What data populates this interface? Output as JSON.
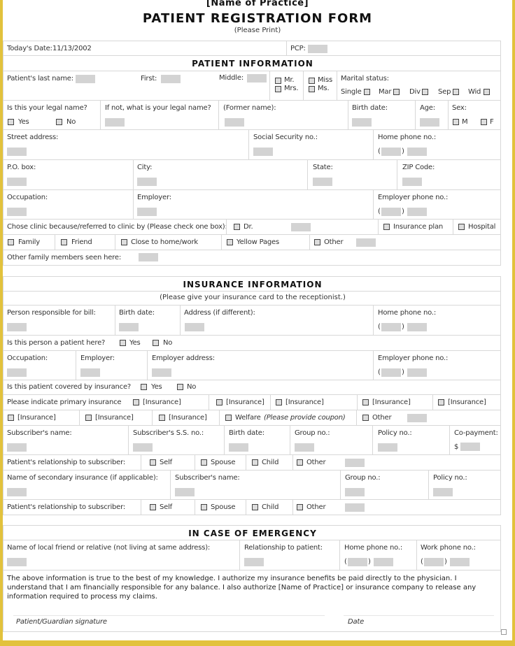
{
  "header": {
    "practice_name": "[Name of Practice]",
    "title": "PATIENT REGISTRATION FORM",
    "subtitle": "(Please Print)"
  },
  "top": {
    "todays_date_label": "Today's Date:",
    "todays_date_value": "11/13/2002",
    "pcp_label": "PCP:"
  },
  "patient_info": {
    "heading": "PATIENT INFORMATION",
    "last_name": "Patient's last name:",
    "first": "First:",
    "middle": "Middle:",
    "titles": [
      "Mr.",
      "Mrs.",
      "Miss",
      "Ms."
    ],
    "marital_status": "Marital status:",
    "marital_options": [
      "Single",
      "Mar",
      "Div",
      "Sep",
      "Wid"
    ],
    "legal_name_q": "Is this your legal name?",
    "yes": "Yes",
    "no": "No",
    "if_not": "If not, what is your legal name?",
    "former_name": "(Former name):",
    "birth_date": "Birth date:",
    "age": "Age:",
    "sex": "Sex:",
    "sex_options": [
      "M",
      "F"
    ],
    "street": "Street address:",
    "ssn": "Social Security no.:",
    "home_phone": "Home phone no.:",
    "po_box": "P.O. box:",
    "city": "City:",
    "state": "State:",
    "zip": "ZIP Code:",
    "occupation": "Occupation:",
    "employer": "Employer:",
    "employer_phone": "Employer phone no.:",
    "paren_open": "(",
    "paren_close": ")",
    "chose_clinic": "Chose clinic because/referred to clinic by (Please check one box):",
    "referral_row1": [
      "Dr.",
      "Insurance plan",
      "Hospital"
    ],
    "referral_row2": [
      "Family",
      "Friend",
      "Close to home/work",
      "Yellow Pages",
      "Other"
    ],
    "other_family": "Other family members seen here:"
  },
  "insurance_info": {
    "heading": "INSURANCE INFORMATION",
    "note": "(Please give your insurance card to the receptionist.)",
    "person_responsible": "Person responsible for bill:",
    "birth_date": "Birth date:",
    "address": "Address (if different):",
    "home_phone": "Home phone no.:",
    "is_patient_q": "Is this person a patient here?",
    "yes": "Yes",
    "no": "No",
    "occupation": "Occupation:",
    "employer": "Employer:",
    "employer_address": "Employer address:",
    "employer_phone": "Employer phone no.:",
    "covered_q": "Is this patient covered by insurance?",
    "primary_label": "Please indicate primary insurance",
    "insurance_option": "[Insurance]",
    "welfare": "Welfare",
    "welfare_note": "(Please provide coupon)",
    "other": "Other",
    "subscriber_name": "Subscriber's name:",
    "subscriber_ss": "Subscriber's S.S. no.:",
    "group_no": "Group no.:",
    "policy_no": "Policy no.:",
    "copayment": "Co-payment:",
    "dollar": "$",
    "relationship": "Patient's relationship to subscriber:",
    "relationship_options": [
      "Self",
      "Spouse",
      "Child",
      "Other"
    ],
    "secondary": "Name of secondary insurance (if applicable):"
  },
  "emergency": {
    "heading": "IN CASE OF EMERGENCY",
    "friend": "Name of local friend or relative (not living at same address):",
    "relationship": "Relationship to patient:",
    "home_phone": "Home phone no.:",
    "work_phone": "Work phone no.:"
  },
  "authorization": {
    "text": "The above information is true to the best of my knowledge. I authorize my insurance benefits be paid directly to the physician. I understand that I am financially responsible for any balance. I also authorize [Name of Practice] or insurance company to release any information required to process my claims.",
    "signature_label": "Patient/Guardian signature",
    "date_label": "Date"
  }
}
